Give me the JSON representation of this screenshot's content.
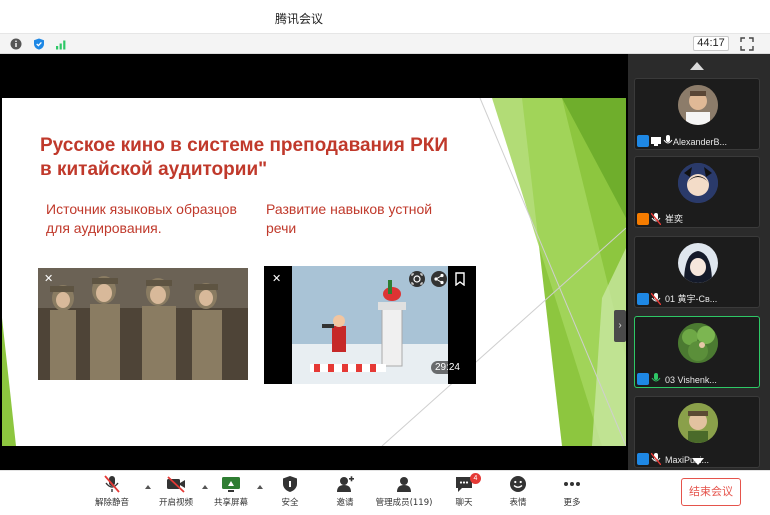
{
  "window": {
    "title": "腾讯会议"
  },
  "infobar": {
    "timer": "44:17"
  },
  "slide": {
    "title": "Русское кино в системе преподавания РКИ в китайской аудитории\"",
    "left_subtitle": "Источник языковых образцов для аудирования.",
    "right_subtitle": "Развитие навыков устной речи",
    "video_duration": "29:24"
  },
  "participants": [
    {
      "name": "AlexanderB...",
      "badge_color": "#1e88e5"
    },
    {
      "name": "崔奕",
      "badge_color": "#f57c00"
    },
    {
      "name": "01 黄宇-Св...",
      "badge_color": "#1e88e5"
    },
    {
      "name": "03 Vishenk...",
      "badge_color": "#1e88e5"
    },
    {
      "name": "MaxiPuzi...",
      "badge_color": "#1e88e5"
    }
  ],
  "toolbar": {
    "unmute": "解除静音",
    "start_video": "开启视频",
    "share_screen": "共享屏幕",
    "security": "安全",
    "invite": "邀请",
    "manage_members": "管理成员(119)",
    "chat": "聊天",
    "chat_badge": "4",
    "reactions": "表情",
    "more": "更多",
    "end_meeting": "结束会议"
  },
  "colors": {
    "accent": "#1e88e5",
    "danger": "#e5534b",
    "slide_red": "#c0392b",
    "slide_green": "#8dc63f"
  }
}
